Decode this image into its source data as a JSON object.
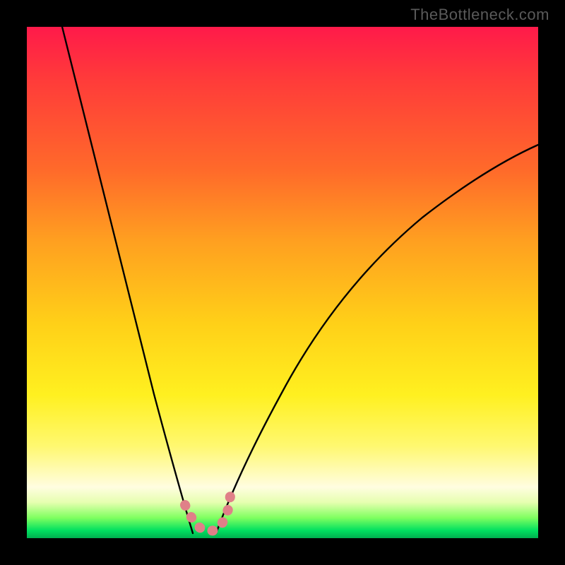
{
  "watermark": {
    "text": "TheBottleneck.com"
  },
  "chart_data": {
    "type": "line",
    "title": "",
    "xlabel": "",
    "ylabel": "",
    "xlim": [
      0,
      100
    ],
    "ylim": [
      0,
      100
    ],
    "grid": false,
    "series": [
      {
        "name": "left-branch",
        "x": [
          7,
          10,
          14,
          18,
          22,
          26,
          29,
          31,
          32.5
        ],
        "y": [
          100,
          82,
          63,
          46,
          30,
          17,
          8,
          3,
          1
        ]
      },
      {
        "name": "right-branch",
        "x": [
          37,
          40,
          44,
          50,
          58,
          68,
          80,
          92,
          100
        ],
        "y": [
          1,
          5,
          12,
          22,
          35,
          49,
          61,
          71,
          77
        ]
      },
      {
        "name": "floor-dots",
        "x": [
          31,
          32,
          32.8,
          33.6,
          34.8,
          36.2,
          37,
          37.6,
          38.2,
          39.0,
          39.8
        ],
        "y": [
          6.5,
          4.2,
          2.6,
          1.8,
          1.4,
          1.6,
          2.6,
          4.2,
          6.2,
          8.6,
          11.2
        ]
      }
    ],
    "legend": false,
    "background": "red-to-green vertical gradient",
    "annotations": []
  }
}
